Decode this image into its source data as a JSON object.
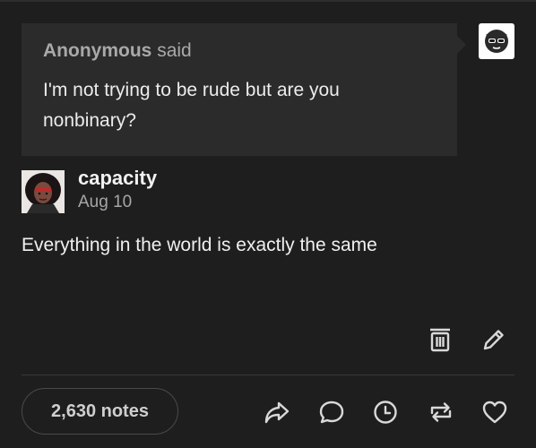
{
  "ask": {
    "asker": "Anonymous",
    "said": "said",
    "question": "I'm not trying to be rude but are you nonbinary?"
  },
  "post": {
    "username": "capacity",
    "date": "Aug 10",
    "answer": "Everything in the world is exactly the same"
  },
  "footer": {
    "notes": "2,630 notes"
  },
  "icons": {
    "answerer_avatar": "sunglasses-face-icon",
    "delete": "trash-icon",
    "edit": "pencil-icon",
    "share": "share-arrow-icon",
    "reply": "speech-bubble-icon",
    "queue": "clock-icon",
    "reblog": "reblog-icon",
    "like": "heart-icon"
  },
  "colors": {
    "background": "#1e1e1e",
    "ask_box": "#2b2b2b",
    "text": "#f0f0f0",
    "muted": "#a6a6a6"
  }
}
